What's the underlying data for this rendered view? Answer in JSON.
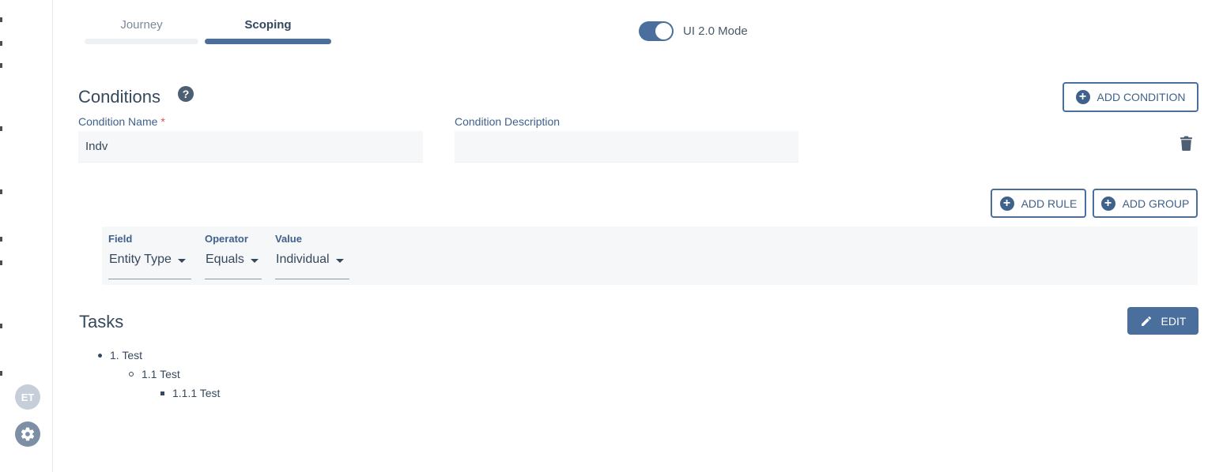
{
  "sidebar": {
    "avatar_initials": "ET",
    "settings_icon": "gear-icon"
  },
  "tabs": [
    {
      "label": "Journey",
      "active": false
    },
    {
      "label": "Scoping",
      "active": true
    }
  ],
  "toggle": {
    "label": "UI 2.0 Mode",
    "on": true
  },
  "conditions": {
    "title": "Conditions",
    "help_icon": "?",
    "add_condition_label": "ADD CONDITION",
    "name_label": "Condition Name",
    "name_required_marker": "*",
    "name_value": "Indv",
    "description_label": "Condition Description",
    "description_value": "",
    "add_rule_label": "ADD RULE",
    "add_group_label": "ADD GROUP",
    "rule": {
      "field_header": "Field",
      "field_value": "Entity Type",
      "operator_header": "Operator",
      "operator_value": "Equals",
      "value_header": "Value",
      "value_value": "Individual"
    }
  },
  "tasks": {
    "title": "Tasks",
    "edit_label": "EDIT",
    "items": [
      "1. Test",
      "1.1 Test",
      "1.1.1 Test"
    ]
  },
  "colors": {
    "accent": "#4a6f9c",
    "accent_text": "#3f618c",
    "required": "#d9534f",
    "input_bg": "#f6f7f9"
  }
}
